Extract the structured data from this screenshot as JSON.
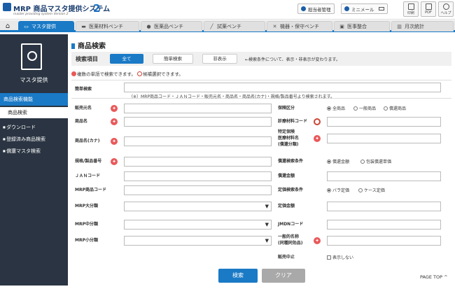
{
  "header": {
    "title": "MRP 商品マスタ提供システム",
    "version": "2",
    "subtitle": "master providing system Version 2",
    "manager_label": "担当者管理",
    "mail_label": "ミニメール",
    "tools": [
      {
        "label": "印刷",
        "icon": "print-icon"
      },
      {
        "label": "PDF",
        "icon": "pdf-icon"
      },
      {
        "label": "ヘルプ",
        "icon": "help-icon"
      }
    ]
  },
  "nav": {
    "tabs": [
      {
        "label": "マスタ提供",
        "icon": "monitor-icon",
        "active": true
      },
      {
        "label": "医薬材料ベンチ",
        "icon": "bandage-icon"
      },
      {
        "label": "医薬品ベンチ",
        "icon": "pill-icon"
      },
      {
        "label": "試薬ベンチ",
        "icon": "syringe-icon"
      },
      {
        "label": "機器・保守ベンチ",
        "icon": "tools-icon"
      },
      {
        "label": "医事整合",
        "icon": "screen-icon"
      },
      {
        "label": "月次統計",
        "icon": "chart-icon"
      }
    ]
  },
  "sidebar": {
    "title": "マスタ提供",
    "section": "商品検索機能",
    "current": "商品検索",
    "links": [
      "ダウンロード",
      "登録済み商品検索",
      "償還マスタ検索"
    ]
  },
  "main": {
    "page_title": "商品検索",
    "search_label": "検索項目",
    "segments": [
      "全て",
      "簡単検索",
      "非表示"
    ],
    "bar_note": "←検索条件について、表示・非表示が変わります。",
    "hint_star": "複数の単語で検索できます。",
    "hint_pin": "候補選択できます。",
    "simple_label": "簡単検索",
    "simple_note": "（※）MRP商品コード・ＪＡＮコード・販売元名・商品名・商品名(カナ)・規格/製品番号より検索されます。",
    "left_fields": [
      "販売元名",
      "商品名",
      "商品名(カナ)",
      "規格/製品番号",
      "ＪＡＮコード",
      "MRP商品コード",
      "MRP大分類",
      "MRP中分類",
      "MRP小分類"
    ],
    "right_fields": {
      "hoken_kubun": "保険区分",
      "shinryo_code": "診療材料コード",
      "tokutei_line1": "特定保険",
      "tokutei_line2": "医療材料名",
      "tokutei_line3": "(償還分類)",
      "shokan_joken": "償還検索条件",
      "shokan_kingaku": "償還金額",
      "teika_joken": "定価検索条件",
      "teika_kingaku": "定価金額",
      "jmdn": "JMDNコード",
      "ippan_line1": "一般的名称",
      "ippan_line2": "(同種同効品)",
      "hanbai_chushi": "販売中止"
    },
    "radio_hoken": [
      "全商品",
      "一般商品",
      "償還商品"
    ],
    "radio_shokan": [
      "償還金額",
      "包装償還単価"
    ],
    "radio_teika": [
      "バラ定価",
      "ケース定価"
    ],
    "checkbox_hide": "表示しない",
    "search_button": "検索",
    "clear_button": "クリア",
    "page_top": "PAGE TOP"
  }
}
